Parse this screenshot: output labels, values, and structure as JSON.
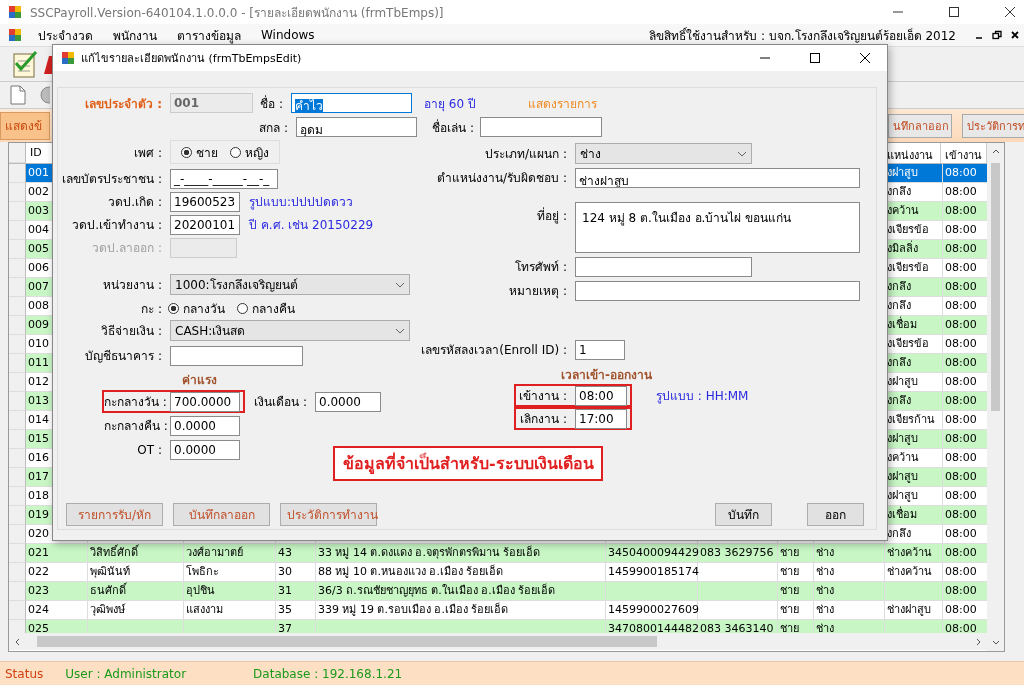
{
  "window": {
    "title": "SSCPayroll.Version-640104.1.0.0.0 - [รายละเอียดพนักงาน (frmTbEmps)]"
  },
  "menu": {
    "items": [
      "ประจำงวด",
      "พนักงาน",
      "ตารางข้อมูล",
      "Windows"
    ],
    "license": "ลิขสิทธิ์ใช้งานสำหรับ : บจก.โรงกลึงเจริญยนต์ร้อยเอ็ด 2012"
  },
  "action_bar": {
    "left_button": "แสดงข้",
    "right_buttons": [
      "นทึกลาออก",
      "ประวัติการท"
    ]
  },
  "table": {
    "header": {
      "id": "ID",
      "position": "แหน่งงาน",
      "start_time": "เข้างาน"
    },
    "rows": [
      {
        "id": "001",
        "position": "งฝาสูบ",
        "start_time": "08:00",
        "selected": true
      },
      {
        "id": "002",
        "position": "งกลึง",
        "start_time": "08:00",
        "selected": false
      },
      {
        "id": "003",
        "position": "งคว้าน",
        "start_time": "08:00",
        "selected": false
      },
      {
        "id": "004",
        "position": "งเจียรข้อ",
        "start_time": "08:00",
        "selected": false
      },
      {
        "id": "005",
        "position": "งมิลลิ่ง",
        "start_time": "08:00",
        "selected": false
      },
      {
        "id": "006",
        "position": "งเจียรข้อ",
        "start_time": "08:00",
        "selected": false
      },
      {
        "id": "007",
        "position": "งกลึง",
        "start_time": "08:00",
        "selected": false
      },
      {
        "id": "008",
        "position": "งกลึง",
        "start_time": "08:00",
        "selected": false
      },
      {
        "id": "009",
        "position": "งเชื่อม",
        "start_time": "08:00",
        "selected": false
      },
      {
        "id": "010",
        "position": "งเจียรข้อ",
        "start_time": "08:00",
        "selected": false
      },
      {
        "id": "011",
        "position": "งกลึง",
        "start_time": "08:00",
        "selected": false
      },
      {
        "id": "012",
        "position": "งฝาสูบ",
        "start_time": "08:00",
        "selected": false
      },
      {
        "id": "013",
        "position": "งกลึง",
        "start_time": "08:00",
        "selected": false
      },
      {
        "id": "014",
        "position": "งเจียรก้าน",
        "start_time": "08:00",
        "selected": false
      },
      {
        "id": "015",
        "position": "งฝาสูบ",
        "start_time": "08:00",
        "selected": false
      },
      {
        "id": "016",
        "position": "งคว้าน",
        "start_time": "08:00",
        "selected": false
      },
      {
        "id": "017",
        "position": "งฝาสูบ",
        "start_time": "08:00",
        "selected": false
      },
      {
        "id": "018",
        "position": "งฝาสูบ",
        "start_time": "08:00",
        "selected": false
      },
      {
        "id": "019",
        "position": "งเชื่อม",
        "start_time": "08:00",
        "selected": false
      },
      {
        "id": "020",
        "position": "งกลึง",
        "start_time": "08:00",
        "selected": false
      },
      {
        "id": "021",
        "first_name": "วิสิทธิ์ศักดิ์",
        "last_name": "วงศ์อามาตย์",
        "age": "43",
        "address": "33 หมู่ 14 ต.ดงแดง อ.จตุรพักตรพิมาน ร้อยเอ็ด",
        "id_card": "3450400094429",
        "phone": "083 3629756",
        "gender": "ชาย",
        "type": "ช่าง",
        "position": "ช่างคว้าน",
        "start_time": "08:00",
        "selected": false
      },
      {
        "id": "022",
        "first_name": "พุฒินันท์",
        "last_name": "โพธิกะ",
        "age": "30",
        "address": "88 หมู่ 10 ต.หนองแวง อ.เมือง ร้อยเอ็ด",
        "id_card": "1459900185174",
        "gender": "ชาย",
        "type": "ช่าง",
        "position": "ช่างคว้าน",
        "start_time": "08:00",
        "selected": false
      },
      {
        "id": "023",
        "first_name": "ธนศักดิ์",
        "last_name": "อุปชิน",
        "age": "31",
        "address": "36/3 ถ.รณชัยชาญยุทธ ต.ในเมือง อ.เมือง ร้อยเอ็ด",
        "gender": "ชาย",
        "type": "ช่าง",
        "start_time": "08:00",
        "selected": false
      },
      {
        "id": "024",
        "first_name": "วุฒิพงษ์",
        "last_name": "แสงงาม",
        "age": "35",
        "address": "339 หมู่ 19 ต.รอบเมือง อ.เมือง  ร้อยเอ็ด",
        "id_card": "1459900027609",
        "gender": "ชาย",
        "type": "ช่าง",
        "position": "ช่างฝาสูบ",
        "start_time": "08:00",
        "selected": false
      },
      {
        "id": "025",
        "age": "37",
        "id_card": "3470800144482",
        "phone": "083 3463140",
        "gender": "ชาย",
        "type": "ช่าง",
        "start_time": "08:00",
        "selected": false
      }
    ]
  },
  "status_bar": {
    "status": "Status",
    "user": "User : Administrator",
    "database": "Database : 192.168.1.21"
  },
  "dialog": {
    "title": "แก้ไขรายละเอียดพนักงาน (frmTbEmpsEdit)",
    "employee_id": {
      "label": "เลขประจำตัว :",
      "value": "001"
    },
    "first_name": {
      "label": "ชื่อ :",
      "value": "คำไว",
      "focused": true
    },
    "age": "อายุ 60 ปี",
    "show_list_link": "แสดงรายการ",
    "last_name": {
      "label": "สกล :",
      "value": "อุดม"
    },
    "nickname": {
      "label": "ชื่อเล่น :"
    },
    "gender": {
      "label": "เพศ :",
      "options": [
        {
          "label": "ชาย",
          "selected": true
        },
        {
          "label": "หญิง",
          "selected": false
        }
      ]
    },
    "id_card": {
      "label": "เลขบัตรประชาชน :",
      "value": "_-____-_____-__-_"
    },
    "birth_date": {
      "label": "วดป.เกิด :",
      "value": "19600523",
      "hint": "รูปแบบ:ปปปปดดวว"
    },
    "start_date": {
      "label": "วดป.เข้าทำงาน :",
      "value": "20200101",
      "hint": "ปี ค.ศ. เช่น 20150229"
    },
    "leave_date": {
      "label": "วดป.ลาออก :",
      "disabled": true
    },
    "department": {
      "label": "หน่วยงาน :",
      "value": "1000:โรงกลึงเจริญยนต์"
    },
    "shift": {
      "label": "กะ :",
      "options": [
        {
          "label": "กลางวัน",
          "selected": true
        },
        {
          "label": "กลางคืน",
          "selected": false
        }
      ]
    },
    "payment": {
      "label": "วิธีจ่ายเงิน :",
      "value": "CASH:เงินสด"
    },
    "bank_account": {
      "label": "บัญชีธนาคาร :"
    },
    "wage_heading": "ค่าแรง",
    "wages": [
      {
        "label": "กะกลางวัน :",
        "value": "700.0000",
        "highlighted": true
      },
      {
        "label": "กะกลางคืน :",
        "value": "0.0000",
        "highlighted": false
      },
      {
        "label": "OT :",
        "value": "0.0000",
        "highlighted": false
      }
    ],
    "salary": {
      "label": "เงินเดือน :",
      "value": "0.0000"
    },
    "category": {
      "label": "ประเภท/แผนก :",
      "value": "ช่าง"
    },
    "position": {
      "label": "ตำแหน่งงาน/รับผิดชอบ :",
      "value": "ช่างฝาสูบ"
    },
    "address": {
      "label": "ที่อยู่  :",
      "value": "124 หมู่ 8 ต.ในเมือง อ.บ้านไผ่  ขอนแก่น"
    },
    "phone": {
      "label": "โทรศัพท์ :"
    },
    "note": {
      "label": "หมายเหตุ :"
    },
    "enroll_id": {
      "label": "เลขรหัสลงเวลา(Enroll ID) :",
      "value": "1"
    },
    "time_heading": "เวลาเข้า-ออกงาน",
    "times": [
      {
        "label": "เข้างาน :",
        "value": "08:00",
        "highlighted": true
      },
      {
        "label": "เลิกงาน :",
        "value": "17:00",
        "highlighted": true
      }
    ],
    "time_hint": "รูปแบบ : HH:MM",
    "notice": "ข้อมูลที่จำเป็นสำหรับ-ระบบเงินเดือน",
    "left_buttons": [
      "รายการรับ/หัก",
      "บันทึกลาออก",
      "ประวัติการทำงาน"
    ],
    "right_buttons": [
      "บันทึก",
      "ออก"
    ]
  }
}
